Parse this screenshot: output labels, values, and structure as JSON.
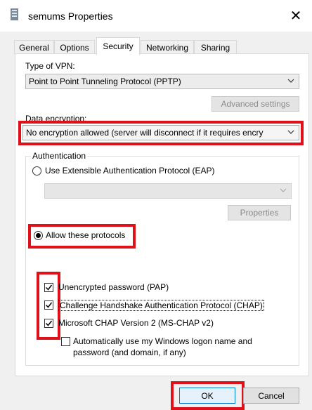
{
  "window": {
    "title": "semums Properties",
    "close_glyph": "✕"
  },
  "tabs": [
    {
      "label": "General"
    },
    {
      "label": "Options"
    },
    {
      "label": "Security"
    },
    {
      "label": "Networking"
    },
    {
      "label": "Sharing"
    }
  ],
  "security": {
    "vpn_type_label": "Type of VPN:",
    "vpn_type_value": "Point to Point Tunneling Protocol (PPTP)",
    "advanced_settings": "Advanced settings",
    "encryption_label": "Data encryption:",
    "encryption_value": "No encryption allowed (server will disconnect if it requires encry",
    "auth_group_title": "Authentication",
    "eap_radio": "Use Extensible Authentication Protocol (EAP)",
    "eap_select_value": "",
    "properties_button": "Properties",
    "allow_radio": "Allow these protocols",
    "protocols": [
      {
        "label": "Unencrypted password (PAP)",
        "checked": true
      },
      {
        "label": "Challenge Handshake Authentication Protocol (CHAP)",
        "checked": true
      },
      {
        "label": "Microsoft CHAP Version 2 (MS-CHAP v2)",
        "checked": true
      }
    ],
    "auto_logon_line1": "Automatically use my Windows logon name and",
    "auto_logon_line2": "password (and domain, if any)",
    "auto_logon_checked": false
  },
  "buttons": {
    "ok": "OK",
    "cancel": "Cancel"
  },
  "colors": {
    "highlight": "#e0101a",
    "ok_border": "#0078d7"
  }
}
